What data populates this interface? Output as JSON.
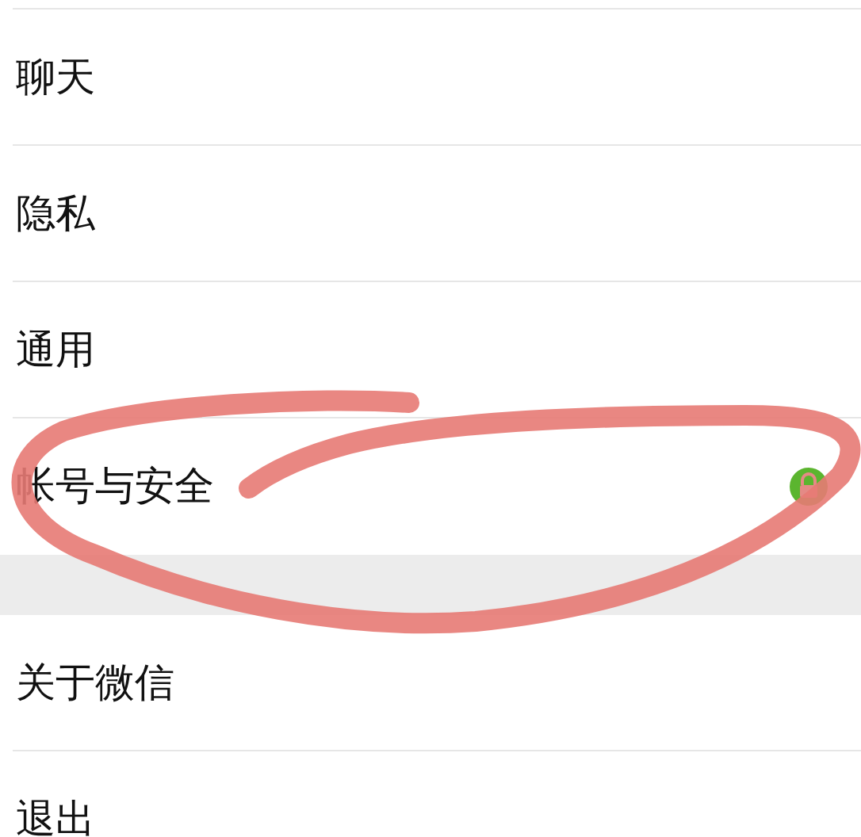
{
  "groups": [
    {
      "items": [
        {
          "label": "聊天",
          "kind": "plain"
        },
        {
          "label": "隐私",
          "kind": "plain"
        },
        {
          "label": "通用",
          "kind": "plain"
        },
        {
          "label": "帐号与安全",
          "kind": "secured"
        }
      ]
    },
    {
      "items": [
        {
          "label": "关于微信",
          "kind": "plain"
        },
        {
          "label": "退出",
          "kind": "plain"
        }
      ]
    }
  ]
}
